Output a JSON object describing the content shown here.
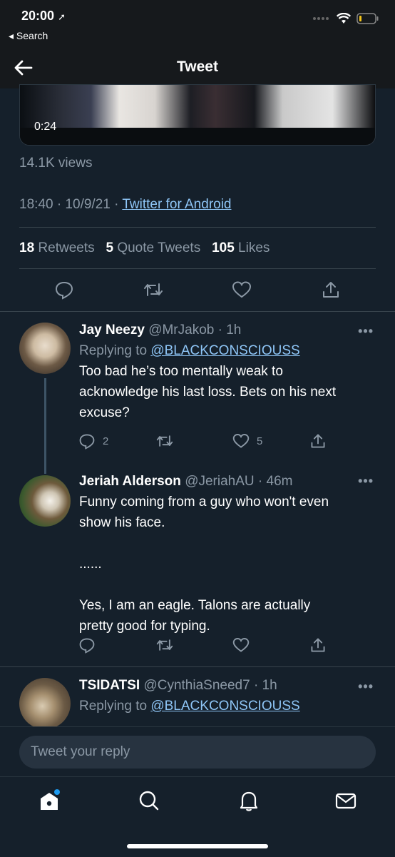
{
  "status_bar": {
    "time": "20:00",
    "back_app": "◂ Search"
  },
  "nav": {
    "title": "Tweet"
  },
  "video": {
    "duration": "0:24"
  },
  "tweet": {
    "views": "14.1K views",
    "time_date": "18:40 · 10/9/21 · ",
    "source": "Twitter for Android",
    "retweets_count": "18",
    "retweets_label": "Retweets",
    "quotes_count": "5",
    "quotes_label": "Quote Tweets",
    "likes_count": "105",
    "likes_label": "Likes"
  },
  "replies": [
    {
      "name": "Jay Neezy",
      "handle": "@MrJakob",
      "time": "· 1h",
      "replying_label": "Replying to ",
      "replying_to": "@BLACKCONSCIOUSS",
      "text_lines": [
        "Too bad he’s too mentally weak to",
        "acknowledge his last loss. Bets on his next",
        "excuse?"
      ],
      "replies": "2",
      "likes": "5"
    },
    {
      "name": "Jeriah Alderson",
      "handle": "@JeriahAU",
      "time": "· 46m",
      "text_lines": [
        "Funny coming from a guy who won't even",
        "show his face.",
        "",
        "......",
        "",
        "Yes, I am an eagle. Talons are actually",
        "pretty good for typing."
      ],
      "replies": "",
      "likes": ""
    },
    {
      "name": "TSIDATSI",
      "handle": "@CynthiaSneed7",
      "time": "· 1h",
      "replying_label": "Replying to ",
      "replying_to": "@BLACKCONSCIOUSS"
    }
  ],
  "more_glyph": "•••",
  "compose": {
    "placeholder": "Tweet your reply"
  },
  "icons": {
    "nav": [
      "back-arrow-icon"
    ],
    "actions": [
      "reply-icon",
      "retweet-icon",
      "like-icon",
      "share-icon"
    ],
    "tabs": [
      "home-icon",
      "search-icon",
      "notifications-icon",
      "messages-icon"
    ]
  },
  "colors": {
    "background": "#15202b",
    "link": "#8fc6f7",
    "muted": "#8b98a5",
    "accent": "#1d9bf0"
  }
}
